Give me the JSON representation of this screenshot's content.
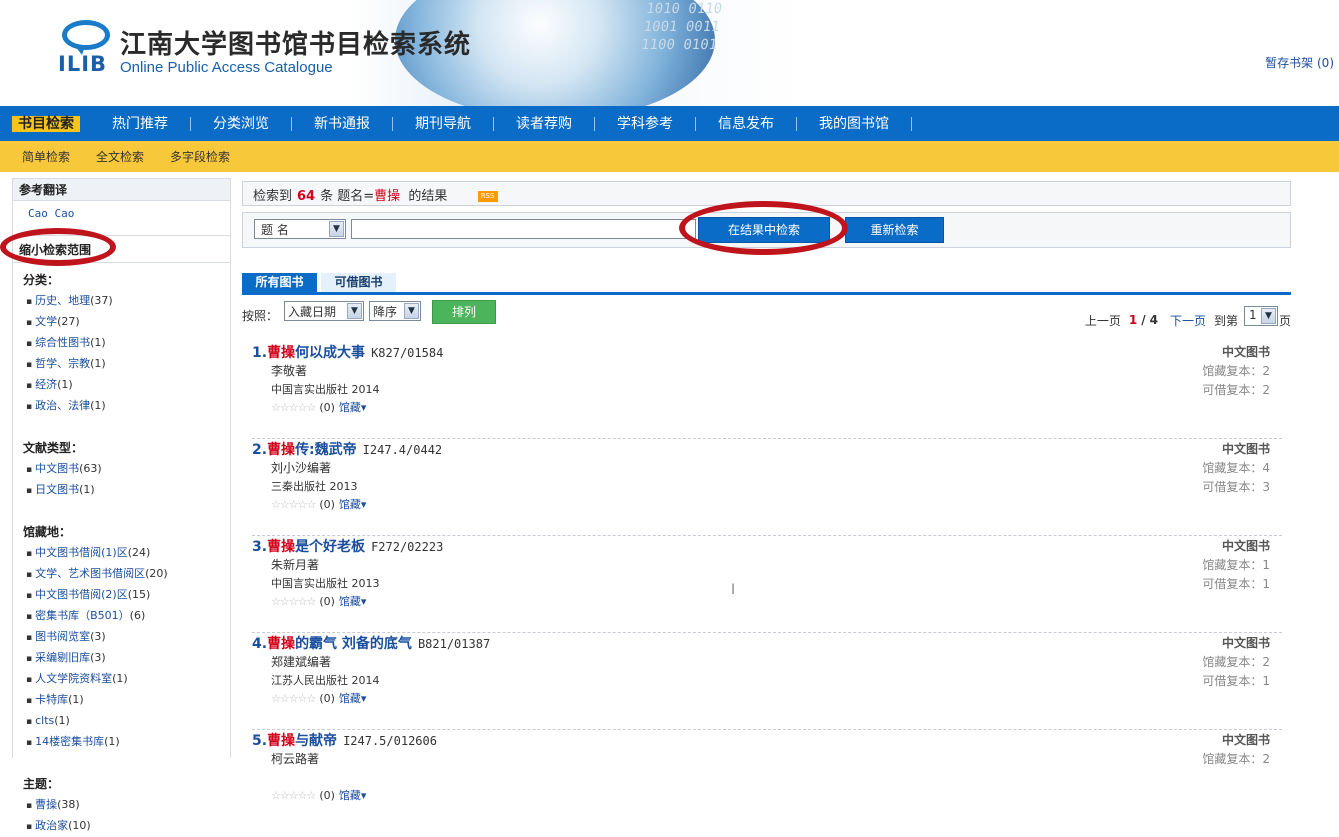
{
  "header": {
    "logo_text": "ILIB",
    "title": "江南大学图书馆书目检索系统",
    "subtitle": "Online Public Access Catalogue",
    "cart_label": "暂存书架",
    "cart_count": "(0)",
    "binary_deco": "1010 0110 1001 0011 1100 0101"
  },
  "main_nav": [
    "书目检索",
    "热门推荐",
    "分类浏览",
    "新书通报",
    "期刊导航",
    "读者荐购",
    "学科参考",
    "信息发布",
    "我的图书馆"
  ],
  "sub_nav": [
    "简单检索",
    "全文检索",
    "多字段检索"
  ],
  "sidebar": {
    "translate_title": "参考翻译",
    "translate_value": "Cao Cao",
    "narrow_title": "缩小检索范围",
    "facets": [
      {
        "title": "分类：",
        "items": [
          {
            "label": "历史、地理",
            "count": "(37)"
          },
          {
            "label": "文学",
            "count": "(27)"
          },
          {
            "label": "综合性图书",
            "count": "(1)"
          },
          {
            "label": "哲学、宗教",
            "count": "(1)"
          },
          {
            "label": "经济",
            "count": "(1)"
          },
          {
            "label": "政治、法律",
            "count": "(1)"
          }
        ]
      },
      {
        "title": "文献类型：",
        "items": [
          {
            "label": "中文图书",
            "count": "(63)"
          },
          {
            "label": "日文图书",
            "count": "(1)"
          }
        ]
      },
      {
        "title": "馆藏地：",
        "items": [
          {
            "label": "中文图书借阅(1)区",
            "count": "(24)"
          },
          {
            "label": "文学、艺术图书借阅区",
            "count": "(20)"
          },
          {
            "label": "中文图书借阅(2)区",
            "count": "(15)"
          },
          {
            "label": "密集书库（B501）",
            "count": "(6)"
          },
          {
            "label": "图书阅览室",
            "count": "(3)"
          },
          {
            "label": "采编剔旧库",
            "count": "(3)"
          },
          {
            "label": "人文学院资料室",
            "count": "(1)"
          },
          {
            "label": "卡特库",
            "count": "(1)"
          },
          {
            "label": "clts",
            "count": "(1)"
          },
          {
            "label": "14楼密集书库",
            "count": "(1)"
          }
        ]
      },
      {
        "title": "主题：",
        "items": [
          {
            "label": "曹操",
            "count": "(38)"
          },
          {
            "label": "政治家",
            "count": "(10)"
          }
        ]
      }
    ]
  },
  "summary": {
    "prefix": "检索到",
    "count": "64",
    "mid": "条  题名=",
    "term": "曹操",
    "suffix": "的结果",
    "rss": "RSS"
  },
  "search": {
    "field": "题 名",
    "query": "",
    "refine_button": "在结果中检索",
    "restart_button": "重新检索"
  },
  "tabs": [
    "所有图书",
    "可借图书"
  ],
  "sort": {
    "label": "按照：",
    "field": "入藏日期",
    "order": "降序",
    "button": "排列"
  },
  "pager": {
    "prev": "上一页",
    "current": "1",
    "sep": "/",
    "total": "4",
    "next": "下一页",
    "goto_label": "到第",
    "goto_value": "1",
    "goto_suffix": "页"
  },
  "records": [
    {
      "num": "1.",
      "hl": "曹操",
      "rest": "何以成大事",
      "call": "K827/01584",
      "author": "李敬著",
      "pub": "中国言实出版社 2014",
      "type": "中文图书",
      "copies": "馆藏复本：2",
      "avail": "可借复本：2"
    },
    {
      "num": "2.",
      "hl": "曹操",
      "rest": "传:魏武帝",
      "call": "I247.4/0442",
      "author": "刘小沙编著",
      "pub": "三秦出版社 2013",
      "type": "中文图书",
      "copies": "馆藏复本：4",
      "avail": "可借复本：3"
    },
    {
      "num": "3.",
      "hl": "曹操",
      "rest": "是个好老板",
      "call": "F272/02223",
      "author": "朱新月著",
      "pub": "中国言实出版社 2013",
      "type": "中文图书",
      "copies": "馆藏复本：1",
      "avail": "可借复本：1"
    },
    {
      "num": "4.",
      "hl": "曹操",
      "rest": "的霸气 刘备的底气",
      "call": "B821/01387",
      "author": "郑建斌编著",
      "pub": "江苏人民出版社 2014",
      "type": "中文图书",
      "copies": "馆藏复本：2",
      "avail": "可借复本：1"
    },
    {
      "num": "5.",
      "hl": "曹操",
      "rest": "与献帝",
      "call": "I247.5/012606",
      "author": "柯云路著",
      "pub": "",
      "type": "中文图书",
      "copies": "馆藏复本：2",
      "avail": ""
    }
  ],
  "rating": {
    "stars": "☆☆☆☆☆",
    "count": "(0)",
    "holdings_label": "馆藏▾"
  },
  "colors": {
    "nav_blue": "#0b6cc7",
    "subnav_yellow": "#f7c93a",
    "highlight_red": "#d0021b",
    "link_blue": "#1a4e9e",
    "annotation_red": "#c0141c"
  }
}
